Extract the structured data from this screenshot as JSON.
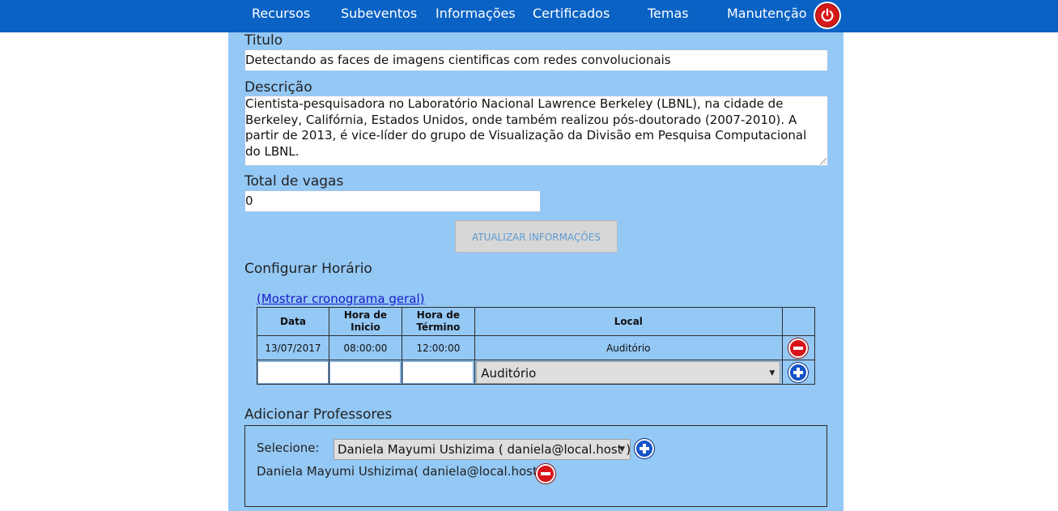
{
  "nav": {
    "items": [
      "Recursos",
      "Subeventos",
      "Informações",
      "Certificados",
      "Temas",
      "Manutenção"
    ],
    "power_color": "#d61818",
    "bar_color": "#0a62c4"
  },
  "form": {
    "title_label": "Titulo",
    "title_value": "Detectando as faces de imagens cientificas com redes convolucionais",
    "description_label": "Descrição",
    "description_value": "Cientista-pesquisadora no Laboratório Nacional Lawrence Berkeley (LBNL), na cidade de Berkeley, Califórnia, Estados Unidos, onde também realizou pós-doutorado (2007-2010). A partir de 2013, é vice-líder do grupo de Visualização da Divisão em Pesquisa Computacional do LBNL.",
    "vagas_label": "Total de vagas",
    "vagas_value": "0",
    "update_button": "ATUALIZAR INFORMAÇÕES"
  },
  "schedule": {
    "section_title": "Configurar Horário",
    "show_link": "(Mostrar cronograma geral)",
    "headers": [
      "Data",
      "Hora de Inicio",
      "Hora de Término",
      "Local",
      ""
    ],
    "rows": [
      {
        "data": "13/07/2017",
        "inicio": "08:00:00",
        "termino": "12:00:00",
        "local": "Auditório"
      }
    ],
    "new_row": {
      "local_selected": "Auditório"
    }
  },
  "professors": {
    "section_title": "Adicionar Professores",
    "select_label": "Selecione:",
    "select_value": "Daniela Mayumi Ushizima ( daniela@local.host )",
    "added": [
      "Daniela Mayumi Ushizima( daniela@local.host )"
    ]
  },
  "colors": {
    "panel_bg": "#94c8f5",
    "remove_icon": "#d8141a",
    "add_icon": "#1554c7"
  },
  "icons": {
    "power": "power-icon",
    "remove": "remove-circle-icon",
    "add": "add-circle-icon"
  }
}
